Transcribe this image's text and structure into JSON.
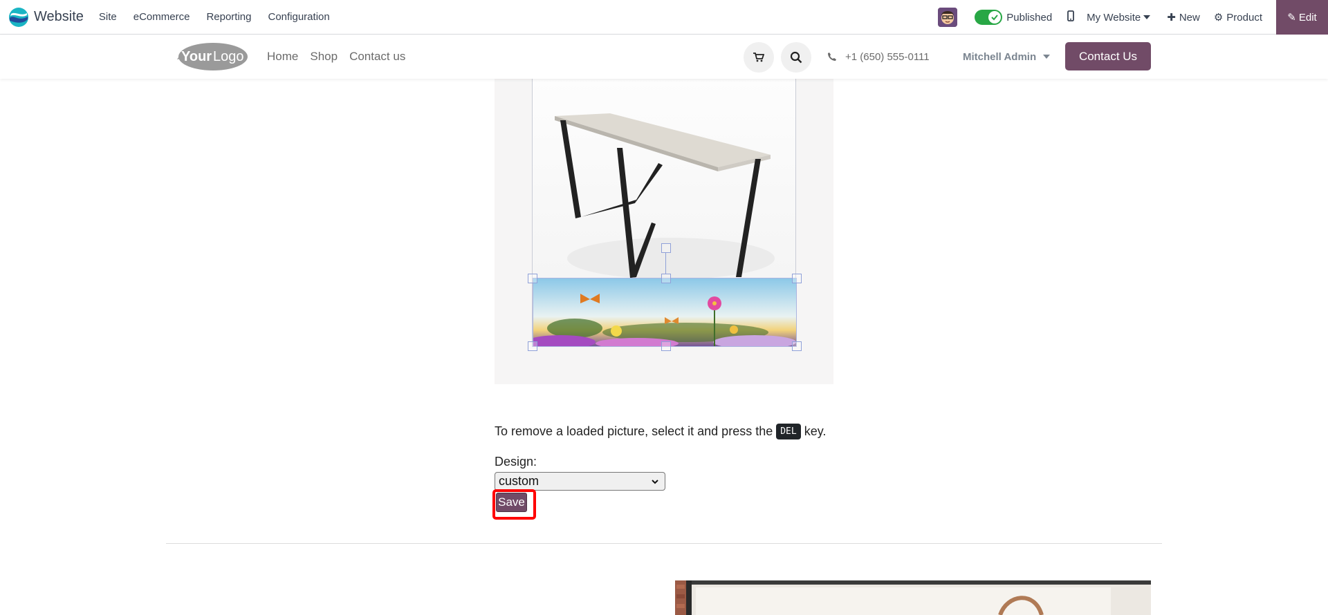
{
  "topbar": {
    "app_name": "Website",
    "menu": [
      "Site",
      "eCommerce",
      "Reporting",
      "Configuration"
    ],
    "published_label": "Published",
    "website_label": "My Website",
    "new_label": "New",
    "product_label": "Product",
    "edit_label": "Edit"
  },
  "site_header": {
    "nav": [
      "Home",
      "Shop",
      "Contact us"
    ],
    "phone": "+1 (650) 555-0111",
    "user": "Mitchell Admin",
    "contact_button": "Contact Us"
  },
  "content": {
    "info_before": "To remove a loaded picture, select it and press the",
    "info_key": "DEL",
    "info_after": "key.",
    "design_label": "Design:",
    "design_value": "custom",
    "save_label": "Save"
  },
  "colors": {
    "brand": "#714b67",
    "toggle_on": "#28a745",
    "highlight": "#ff0000"
  }
}
